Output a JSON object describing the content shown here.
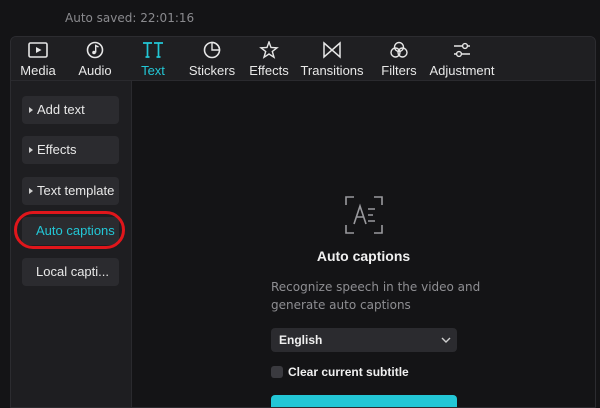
{
  "header": {
    "autosave_text": "Auto saved: 22:01:16"
  },
  "colors": {
    "accent": "#23c7d6",
    "annotation": "#e0161b"
  },
  "tabs": [
    {
      "label": "Media",
      "icon": "media-icon"
    },
    {
      "label": "Audio",
      "icon": "audio-icon"
    },
    {
      "label": "Text",
      "icon": "text-icon",
      "active": true
    },
    {
      "label": "Stickers",
      "icon": "stickers-icon"
    },
    {
      "label": "Effects",
      "icon": "effects-icon"
    },
    {
      "label": "Transitions",
      "icon": "transitions-icon"
    },
    {
      "label": "Filters",
      "icon": "filters-icon"
    },
    {
      "label": "Adjustment",
      "icon": "adjustment-icon"
    }
  ],
  "sidebar": {
    "items": [
      {
        "label": "Add text"
      },
      {
        "label": "Effects"
      },
      {
        "label": "Text template"
      },
      {
        "label": "Auto captions",
        "active": true
      },
      {
        "label": "Local capti..."
      }
    ]
  },
  "main": {
    "icon": "auto-captions-icon",
    "title": "Auto captions",
    "description": "Recognize speech in the video and generate auto captions",
    "language_select": {
      "value": "English"
    },
    "checkbox_label": "Clear current subtitle",
    "checkbox_checked": false
  }
}
